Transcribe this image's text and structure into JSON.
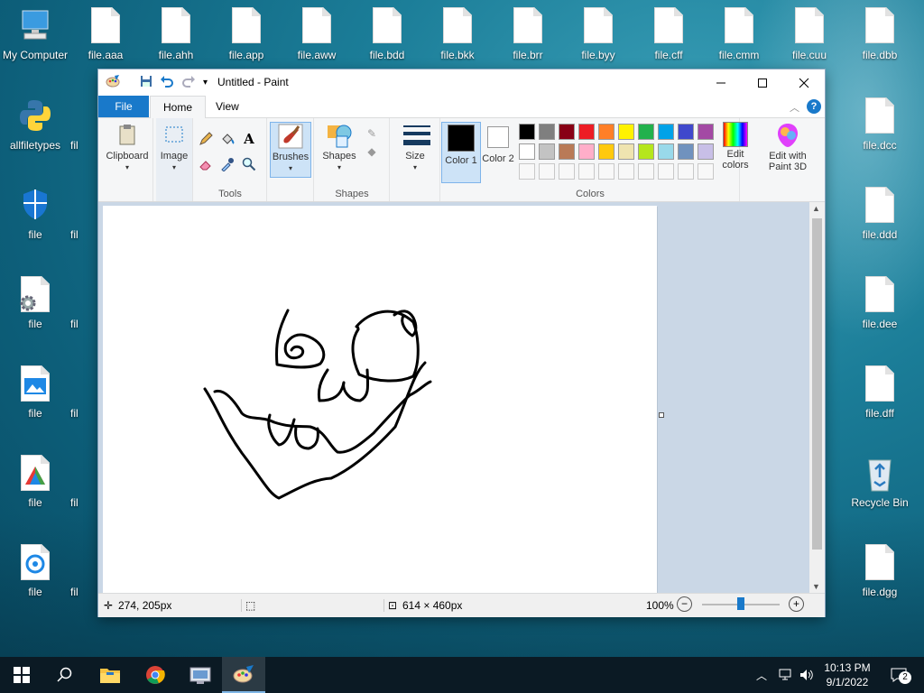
{
  "desktop": {
    "icons_col1": [
      {
        "label": "My Computer",
        "icon": "computer-icon"
      },
      {
        "label": "allfiletypes",
        "icon": "python-icon"
      },
      {
        "label": "file",
        "icon": "shield-icon"
      },
      {
        "label": "file",
        "icon": "gear-file-icon"
      },
      {
        "label": "file",
        "icon": "image-file-icon"
      },
      {
        "label": "file",
        "icon": "prism-icon"
      },
      {
        "label": "file",
        "icon": "disc-icon"
      }
    ],
    "icons_top": [
      "file.aaa",
      "file.ahh",
      "file.app",
      "file.aww",
      "file.bdd",
      "file.bkk",
      "file.brr",
      "file.byy",
      "file.cff",
      "file.cmm",
      "file.cuu",
      "file.dbb"
    ],
    "icons_right": [
      "file.dcc",
      "file.ddd",
      "file.dee",
      "file.dff"
    ],
    "recycle_bin": "Recycle Bin",
    "icon_bottom_right": "file.dgg",
    "partial_label": "fil"
  },
  "paint": {
    "title": "Untitled - Paint",
    "tabs": {
      "file": "File",
      "home": "Home",
      "view": "View"
    },
    "ribbon": {
      "clipboard": "Clipboard",
      "image": "Image",
      "tools": "Tools",
      "brushes": "Brushes",
      "shapes_btn": "Shapes",
      "shapes_group": "Shapes",
      "size": "Size",
      "color1": "Color 1",
      "color2": "Color 2",
      "colors_group": "Colors",
      "edit_colors": "Edit colors",
      "edit_paint3d": "Edit with Paint 3D"
    },
    "palette_row1": [
      "#000000",
      "#7f7f7f",
      "#880015",
      "#ed1c24",
      "#ff7f27",
      "#fff200",
      "#22b14c",
      "#00a2e8",
      "#3f48cc",
      "#a349a4"
    ],
    "palette_row2": [
      "#ffffff",
      "#c3c3c3",
      "#b97a57",
      "#ffaec9",
      "#ffc90e",
      "#efe4b0",
      "#b5e61d",
      "#99d9ea",
      "#7092be",
      "#c8bfe7"
    ],
    "color1_value": "#000000",
    "color2_value": "#ffffff",
    "status": {
      "cursor_pos": "274, 205px",
      "canvas_size": "614 × 460px",
      "zoom": "100%",
      "zoom_slider_level": 0.5
    }
  },
  "taskbar": {
    "time": "10:13 PM",
    "date": "9/1/2022",
    "notifications": "2"
  }
}
